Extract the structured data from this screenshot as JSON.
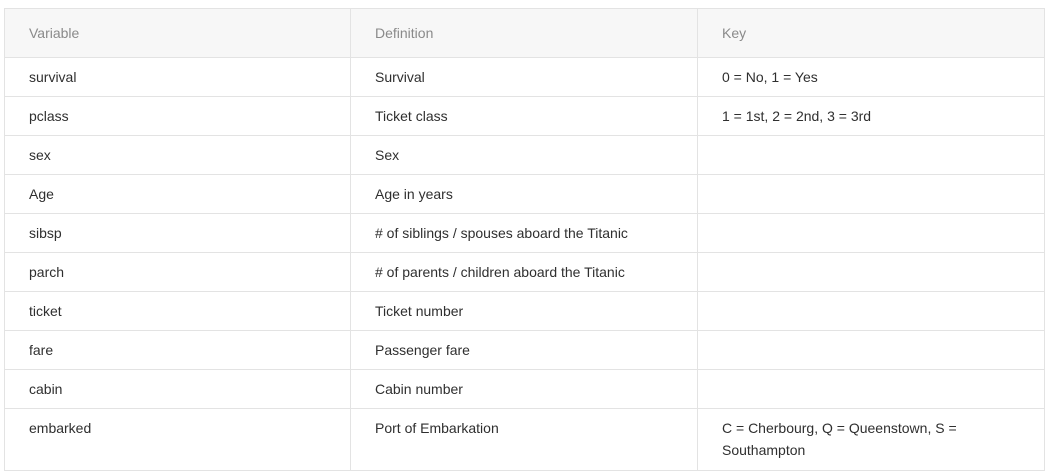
{
  "table": {
    "headers": [
      "Variable",
      "Definition",
      "Key"
    ],
    "rows": [
      {
        "variable": "survival",
        "definition": "Survival",
        "key": "0 = No, 1 = Yes"
      },
      {
        "variable": "pclass",
        "definition": "Ticket class",
        "key": "1 = 1st, 2 = 2nd, 3 = 3rd"
      },
      {
        "variable": "sex",
        "definition": "Sex",
        "key": ""
      },
      {
        "variable": "Age",
        "definition": "Age in years",
        "key": ""
      },
      {
        "variable": "sibsp",
        "definition": "# of siblings / spouses aboard the Titanic",
        "key": ""
      },
      {
        "variable": "parch",
        "definition": "# of parents / children aboard the Titanic",
        "key": ""
      },
      {
        "variable": "ticket",
        "definition": "Ticket number",
        "key": ""
      },
      {
        "variable": "fare",
        "definition": "Passenger fare",
        "key": ""
      },
      {
        "variable": "cabin",
        "definition": "Cabin number",
        "key": ""
      },
      {
        "variable": "embarked",
        "definition": "Port of Embarkation",
        "key": "C = Cherbourg, Q = Queenstown, S = Southampton"
      }
    ]
  }
}
